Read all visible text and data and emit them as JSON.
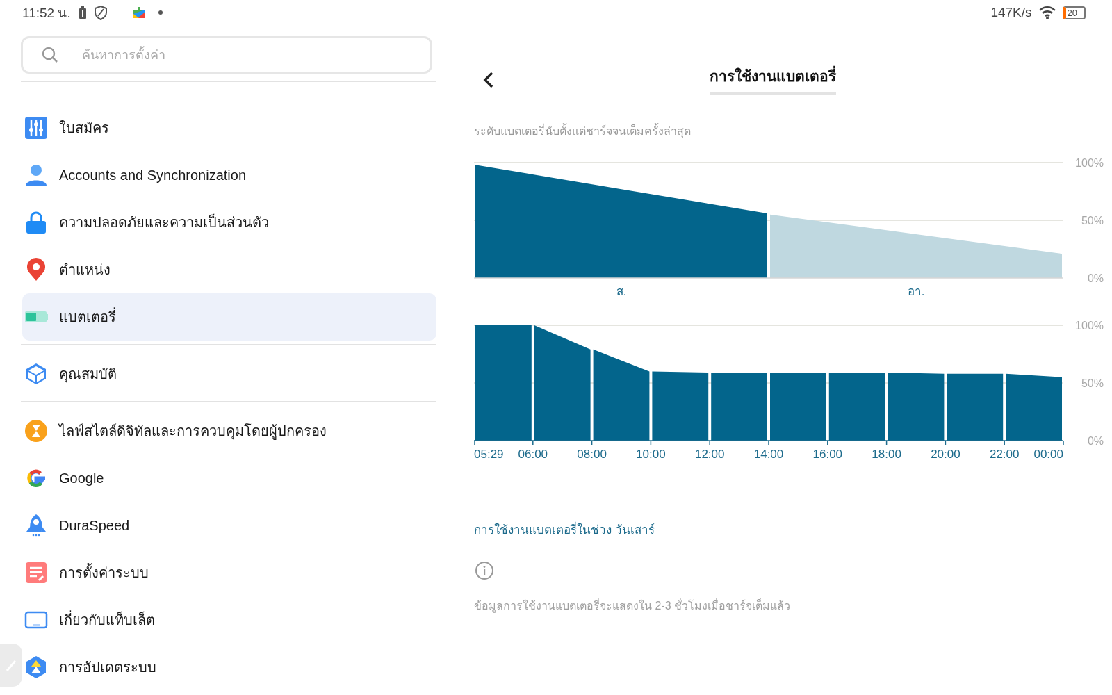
{
  "status_bar": {
    "time": "11:52 น.",
    "speed": "147K/s",
    "battery": "20"
  },
  "search": {
    "placeholder": "ค้นหาการตั้งค่า"
  },
  "sidebar": {
    "groups": [
      {
        "items": [
          {
            "label": "ใบสมัคร",
            "selected": false
          },
          {
            "label": "Accounts and Synchronization",
            "selected": false
          },
          {
            "label": "ความปลอดภัยและความเป็นส่วนตัว",
            "selected": false
          },
          {
            "label": "ตำแหน่ง",
            "selected": false
          },
          {
            "label": "แบตเตอรี่",
            "selected": true
          }
        ]
      },
      {
        "items": [
          {
            "label": "คุณสมบัติ",
            "selected": false
          }
        ]
      },
      {
        "items": [
          {
            "label": "ไลฟ์สไตล์ดิจิทัลและการควบคุมโดยผู้ปกครอง",
            "selected": false
          },
          {
            "label": "Google",
            "selected": false
          },
          {
            "label": "DuraSpeed",
            "selected": false
          },
          {
            "label": "การตั้งค่าระบบ",
            "selected": false
          },
          {
            "label": "เกี่ยวกับแท็บเล็ต",
            "selected": false
          },
          {
            "label": "การอัปเดตระบบ",
            "selected": false
          }
        ]
      }
    ]
  },
  "detail": {
    "title": "การใช้งานแบตเตอรี่",
    "subtitle": "ระดับแบตเตอรี่นับตั้งแต่ชาร์จจนเต็มครั้งล่าสุด",
    "charts": [
      {
        "chart_data": {
          "type": "area",
          "grid": true,
          "categories": [
            null,
            "ส.",
            null,
            "อา.",
            null
          ],
          "ylim": [
            0,
            100
          ],
          "yticks": [
            {
              "value": 0,
              "label": "0%"
            },
            {
              "value": 50,
              "label": "50%"
            },
            {
              "value": 100,
              "label": "100%"
            }
          ],
          "series": [
            {
              "color": "#03658c",
              "values": [
                98,
                77,
                56,
                null,
                null
              ]
            },
            {
              "color": "#bfd8e0",
              "values": [
                null,
                null,
                55,
                38,
                21
              ]
            }
          ]
        }
      },
      {
        "chart_data": {
          "type": "area",
          "grid": true,
          "categories": [
            "05:29",
            "06:00",
            "08:00",
            "10:00",
            "12:00",
            "14:00",
            "16:00",
            "18:00",
            "20:00",
            "22:00",
            "00:00"
          ],
          "ylim": [
            0,
            100
          ],
          "yticks": [
            {
              "value": 0,
              "label": "0%"
            },
            {
              "value": 50,
              "label": "50%"
            },
            {
              "value": 100,
              "label": "100%"
            }
          ],
          "series": [
            {
              "color": "#03658c",
              "values": [
                100,
                100,
                79,
                60,
                59,
                59,
                59,
                59,
                58,
                58,
                55
              ]
            }
          ]
        }
      }
    ],
    "period_link": "การใช้งานแบตเตอรี่ในช่วง วันเสาร์",
    "note": "ข้อมูลการใช้งานแบตเตอรี่จะแสดงใน 2-3 ชั่วโมงเมื่อชาร์จเต็มแล้ว"
  }
}
